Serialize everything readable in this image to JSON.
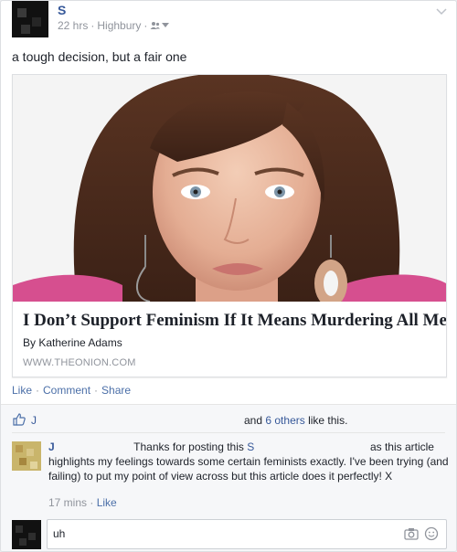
{
  "post": {
    "author": "S",
    "time": "22 hrs",
    "location": "Highbury",
    "audience_icon": "friends-icon",
    "text": "a tough decision, but a fair one"
  },
  "article": {
    "title": "I Don’t Support Feminism If It Means Murdering All Men",
    "byline": "By Katherine Adams",
    "domain": "WWW.THEONION.COM"
  },
  "actions": {
    "like": "Like",
    "comment": "Comment",
    "share": "Share",
    "separator": "·"
  },
  "likes": {
    "name": "J",
    "prefix": "and",
    "others_link": "6 others",
    "suffix": "like this."
  },
  "comment": {
    "author": "J",
    "text_1": "Thanks for posting this",
    "mention": "S",
    "text_2": "as this article highlights my feelings towards some certain feminists exactly. I've been trying (and failing) to put my point of view across but this article does it perfectly! X",
    "time": "17 mins",
    "like": "Like"
  },
  "reply": {
    "value": "uh",
    "icons": [
      "camera-icon",
      "emoji-icon"
    ]
  },
  "colors": {
    "link": "#365899",
    "meta": "#90949c",
    "border": "#dddfe2",
    "feedback_bg": "#f6f7f9"
  }
}
